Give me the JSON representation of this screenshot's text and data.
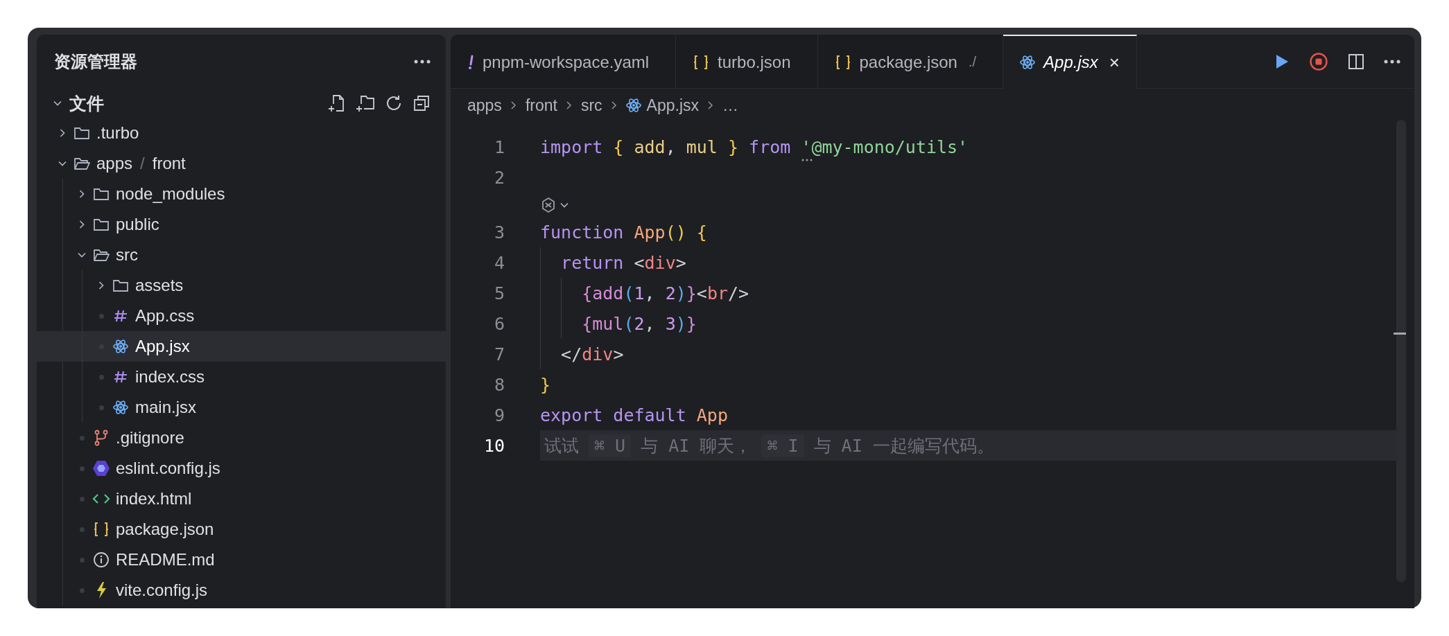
{
  "sidebar": {
    "title": "资源管理器",
    "section": {
      "label": "文件",
      "expanded": true
    },
    "tree": [
      {
        "kind": "folder",
        "segments": [
          ".turbo"
        ],
        "expanded": false,
        "selected": false
      },
      {
        "kind": "folder",
        "segments": [
          "apps",
          "front"
        ],
        "separator": "/",
        "expanded": true,
        "selected": false,
        "children": [
          {
            "kind": "folder",
            "segments": [
              "node_modules"
            ],
            "expanded": false,
            "selected": false
          },
          {
            "kind": "folder",
            "segments": [
              "public"
            ],
            "expanded": false,
            "selected": false
          },
          {
            "kind": "folder",
            "segments": [
              "src"
            ],
            "expanded": true,
            "selected": false,
            "children": [
              {
                "kind": "folder",
                "segments": [
                  "assets"
                ],
                "expanded": false,
                "selected": false
              },
              {
                "kind": "css",
                "segments": [
                  "App.css"
                ],
                "selected": false
              },
              {
                "kind": "react",
                "segments": [
                  "App.jsx"
                ],
                "selected": true
              },
              {
                "kind": "css",
                "segments": [
                  "index.css"
                ],
                "selected": false
              },
              {
                "kind": "react",
                "segments": [
                  "main.jsx"
                ],
                "selected": false
              }
            ]
          },
          {
            "kind": "git",
            "segments": [
              ".gitignore"
            ],
            "selected": false
          },
          {
            "kind": "eslint",
            "segments": [
              "eslint.config.js"
            ],
            "selected": false
          },
          {
            "kind": "html",
            "segments": [
              "index.html"
            ],
            "selected": false
          },
          {
            "kind": "json",
            "segments": [
              "package.json"
            ],
            "selected": false
          },
          {
            "kind": "readme",
            "segments": [
              "README.md"
            ],
            "selected": false
          },
          {
            "kind": "vite",
            "segments": [
              "vite.config.js"
            ],
            "selected": false
          }
        ]
      }
    ]
  },
  "tabs": [
    {
      "kind": "yaml",
      "label": "pnpm-workspace.yaml",
      "selected": false,
      "preview": false
    },
    {
      "kind": "json",
      "label": "turbo.json",
      "selected": false,
      "preview": false
    },
    {
      "kind": "json",
      "label": "package.json",
      "description": "./",
      "selected": false,
      "preview": false
    },
    {
      "kind": "react",
      "label": "App.jsx",
      "selected": true,
      "preview": true,
      "close": "×"
    }
  ],
  "breadcrumbs": [
    {
      "kind": "folder",
      "label": "apps"
    },
    {
      "kind": "folder",
      "label": "front"
    },
    {
      "kind": "folder",
      "label": "src"
    },
    {
      "kind": "react",
      "label": "App.jsx"
    },
    {
      "kind": "more",
      "label": "…"
    }
  ],
  "lines": [
    {
      "kind": "code",
      "number": "1",
      "current": false,
      "tokens": [
        {
          "kind": "keyword",
          "text": "import "
        },
        {
          "kind": "brace",
          "text": "{"
        },
        {
          "kind": "name",
          "text": " add"
        },
        {
          "kind": "plain",
          "text": ", "
        },
        {
          "kind": "name",
          "text": "mul "
        },
        {
          "kind": "brace",
          "text": "}"
        },
        {
          "kind": "keyword",
          "text": " from "
        },
        {
          "kind": "string",
          "text": "'@my-mono/utils'"
        }
      ]
    },
    {
      "kind": "code",
      "number": "2",
      "current": false
    },
    {
      "kind": "lens"
    },
    {
      "kind": "code",
      "number": "3",
      "current": false,
      "tokens": [
        {
          "kind": "keyword",
          "text": "function "
        },
        {
          "kind": "function",
          "text": "App"
        },
        {
          "kind": "brace",
          "text": "() {"
        }
      ]
    },
    {
      "kind": "code",
      "number": "4",
      "current": false,
      "tokens": [
        {
          "kind": "keyword",
          "text": "  return"
        },
        {
          "kind": "plain",
          "text": " <"
        },
        {
          "kind": "tag",
          "text": "div"
        },
        {
          "kind": "plain",
          "text": ">"
        }
      ]
    },
    {
      "kind": "code",
      "number": "5",
      "current": false,
      "tokens": [
        {
          "kind": "jsx",
          "text": "    {add"
        },
        {
          "kind": "paren",
          "text": "("
        },
        {
          "kind": "number",
          "text": "1"
        },
        {
          "kind": "plain",
          "text": ", "
        },
        {
          "kind": "number",
          "text": "2"
        },
        {
          "kind": "paren",
          "text": ")"
        },
        {
          "kind": "jsx",
          "text": "}"
        },
        {
          "kind": "plain",
          "text": "<"
        },
        {
          "kind": "tag",
          "text": "br"
        },
        {
          "kind": "plain",
          "text": "/>"
        }
      ]
    },
    {
      "kind": "code",
      "number": "6",
      "current": false,
      "tokens": [
        {
          "kind": "jsx",
          "text": "    {mul"
        },
        {
          "kind": "paren",
          "text": "("
        },
        {
          "kind": "number",
          "text": "2"
        },
        {
          "kind": "plain",
          "text": ", "
        },
        {
          "kind": "number",
          "text": "3"
        },
        {
          "kind": "paren",
          "text": ")"
        },
        {
          "kind": "jsx",
          "text": "}"
        }
      ]
    },
    {
      "kind": "code",
      "number": "7",
      "current": false,
      "tokens": [
        {
          "kind": "plain",
          "text": "  </"
        },
        {
          "kind": "tag",
          "text": "div"
        },
        {
          "kind": "plain",
          "text": ">"
        }
      ]
    },
    {
      "kind": "code",
      "number": "8",
      "current": false,
      "tokens": [
        {
          "kind": "brace",
          "text": "}"
        }
      ]
    },
    {
      "kind": "code",
      "number": "9",
      "current": false,
      "tokens": [
        {
          "kind": "keyword",
          "text": "export default "
        },
        {
          "kind": "function",
          "text": "App"
        }
      ]
    },
    {
      "kind": "code",
      "number": "10",
      "current": true,
      "hint": [
        {
          "kind": "text",
          "text": "试试"
        },
        {
          "kind": "key",
          "text": "⌘ U"
        },
        {
          "kind": "text",
          "text": "与 AI 聊天，"
        },
        {
          "kind": "key",
          "text": "⌘ I"
        },
        {
          "kind": "text",
          "text": "与 AI 一起编写代码。"
        }
      ]
    }
  ]
}
